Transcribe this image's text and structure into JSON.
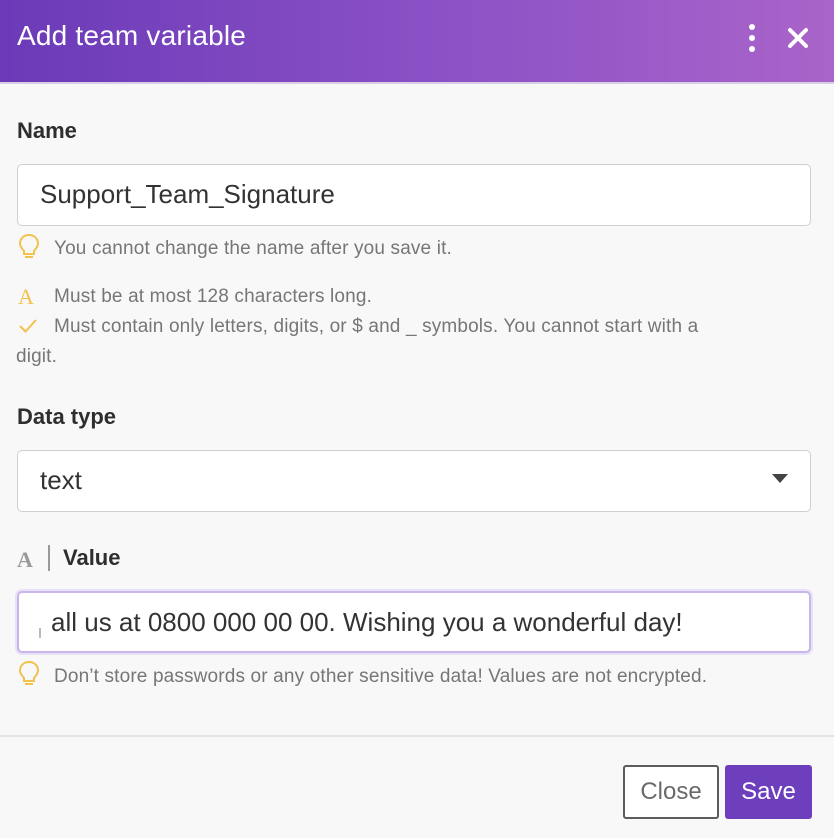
{
  "dialog": {
    "title": "Add team variable",
    "accent_color": "#6e3fbd",
    "header_gradient": [
      "#6b3ab8",
      "#a964c9"
    ]
  },
  "name": {
    "label": "Name",
    "value": "Support_Team_Signature",
    "hint_icon": "lightbulb-icon",
    "hint": "You cannot change the name after you save it.",
    "rules": [
      {
        "icon": "letter-a-icon",
        "text": "Must be at most 128 characters long."
      },
      {
        "icon": "checkmark-icon",
        "text": "Must contain only letters, digits, or $ and _ symbols. You cannot start with a",
        "continuation": "digit."
      }
    ]
  },
  "data_type": {
    "label": "Data type",
    "selected": "text"
  },
  "value": {
    "type_icon": "letter-a-icon",
    "label": "Value",
    "visible_text": "all us at 0800 000 00 00. Wishing you a wonderful day!",
    "hint_icon": "lightbulb-icon",
    "hint": "Don’t store passwords or any other sensitive data! Values are not encrypted."
  },
  "footer": {
    "close_label": "Close",
    "save_label": "Save"
  }
}
